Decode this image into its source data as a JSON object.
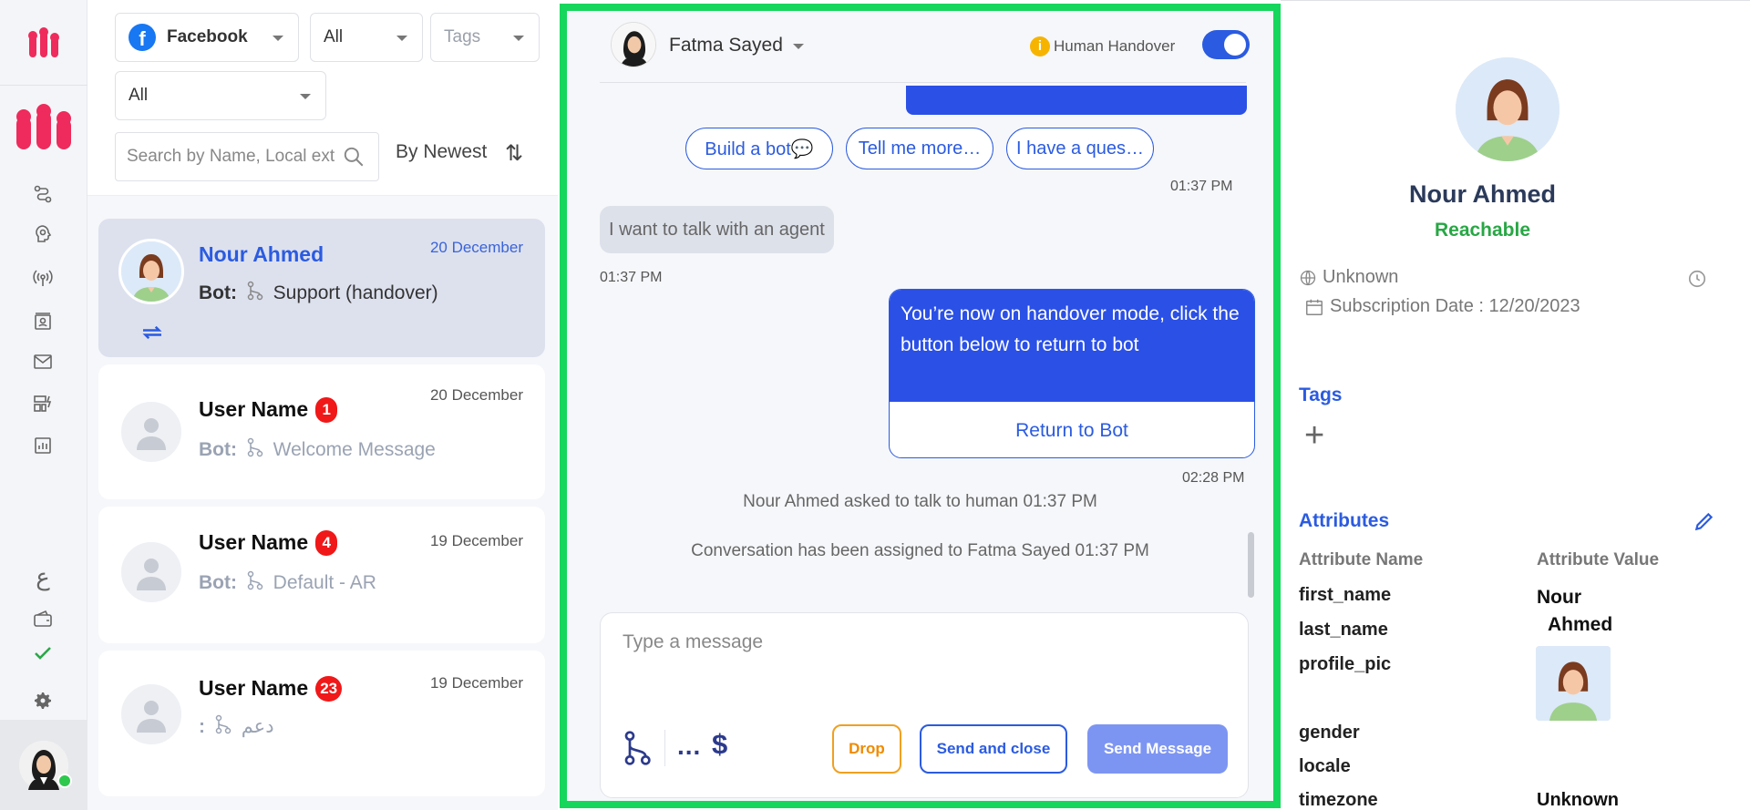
{
  "app": {
    "accent": "#2b5be0",
    "highlight": "#16d65b"
  },
  "filters": {
    "channel": "Facebook",
    "status": "All",
    "tags_placeholder": "Tags",
    "bot_filter": "All",
    "search_placeholder": "Search by Name, Local ext",
    "sort_label": "By Newest"
  },
  "conversations": [
    {
      "name": "Nour Ahmed",
      "date": "20 December",
      "bot_prefix": "Bot:",
      "bot_flow": "Support (handover)",
      "badge": ""
    },
    {
      "name": "User Name",
      "date": "20 December",
      "bot_prefix": "Bot:",
      "bot_flow": "Welcome Message",
      "badge": "1"
    },
    {
      "name": "User Name",
      "date": "19 December",
      "bot_prefix": "Bot:",
      "bot_flow": "Default - AR",
      "badge": "4"
    },
    {
      "name": "User Name",
      "date": "19 December",
      "bot_prefix": ":",
      "bot_flow": "دعم",
      "badge": "23"
    }
  ],
  "chat": {
    "agent_name": "Fatma Sayed",
    "handover_label": "Human Handover",
    "handover_on": true,
    "quick_replies": [
      "Build a bot💬",
      "Tell me more…",
      "I have a ques…"
    ],
    "ts_quick": "01:37 PM",
    "incoming_text": "I want to talk with an agent",
    "ts_incoming": "01:37 PM",
    "outgoing_text": "You’re now on handover mode, click the button below to return to bot",
    "outgoing_button": "Return to Bot",
    "ts_outgoing": "02:28 PM",
    "system_1": "Nour Ahmed asked to talk to human 01:37 PM",
    "system_2": "Conversation has been assigned to Fatma Sayed 01:37 PM",
    "composer_placeholder": "Type a message",
    "dots": "...",
    "dollar": "$",
    "drop_label": "Drop",
    "send_close_label": "Send and close",
    "send_label": "Send Message"
  },
  "profile": {
    "name": "Nour Ahmed",
    "status": "Reachable",
    "location": "Unknown",
    "subscription": "Subscription Date : 12/20/2023",
    "tags_title": "Tags",
    "attributes_title": "Attributes",
    "attr_name_header": "Attribute Name",
    "attr_value_header": "Attribute Value",
    "attributes": [
      {
        "key": "first_name"
      },
      {
        "key": "last_name"
      },
      {
        "key": "profile_pic"
      },
      {
        "key": "gender"
      },
      {
        "key": "locale"
      },
      {
        "key": "timezone"
      }
    ],
    "first_last_value": "Nour Ahmed",
    "timezone_value": "Unknown"
  },
  "rail": {
    "lang_glyph": "ع"
  }
}
